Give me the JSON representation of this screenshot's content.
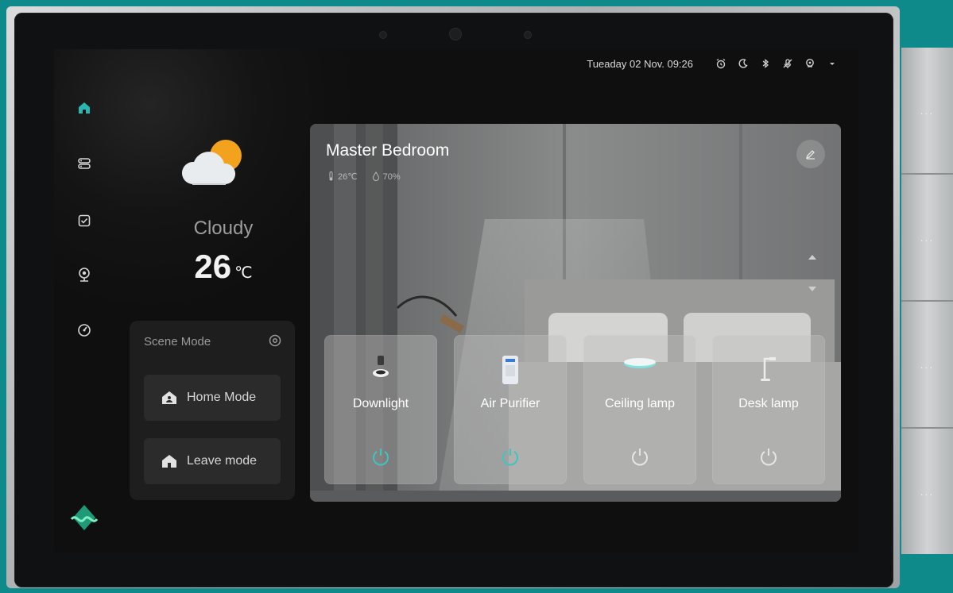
{
  "status_bar": {
    "datetime": "Tueaday 02 Nov. 09:26",
    "icons": [
      "alarm-icon",
      "moon-icon",
      "bluetooth-icon",
      "mic-off-icon",
      "location-icon",
      "wifi-icon"
    ]
  },
  "nav": {
    "items": [
      "home-icon",
      "devices-icon",
      "tasks-icon",
      "camera-icon",
      "timer-icon"
    ],
    "active": "home-icon"
  },
  "weather": {
    "condition": "Cloudy",
    "temperature": "26",
    "unit": "℃"
  },
  "scene": {
    "title": "Scene Mode",
    "modes": [
      {
        "label": "Home Mode",
        "icon": "home-person-icon"
      },
      {
        "label": "Leave mode",
        "icon": "home-icon"
      }
    ]
  },
  "room": {
    "title": "Master Bedroom",
    "temperature": "26℃",
    "humidity": "70%",
    "devices": [
      {
        "label": "Downlight",
        "icon": "downlight-icon",
        "on": true
      },
      {
        "label": "Air Purifier",
        "icon": "air-purifier-icon",
        "on": true
      },
      {
        "label": "Ceiling lamp",
        "icon": "ceiling-lamp-icon",
        "on": false
      },
      {
        "label": "Desk lamp",
        "icon": "desk-lamp-icon",
        "on": false
      }
    ]
  },
  "switch_panel": {
    "buttons": [
      "...",
      "...",
      "...",
      "..."
    ]
  },
  "colors": {
    "accent": "#2bb7b1",
    "background": "#0e8a8a",
    "screen": "#121213",
    "power_on": "#3fc4c0",
    "power_off": "#e6e6e6"
  }
}
